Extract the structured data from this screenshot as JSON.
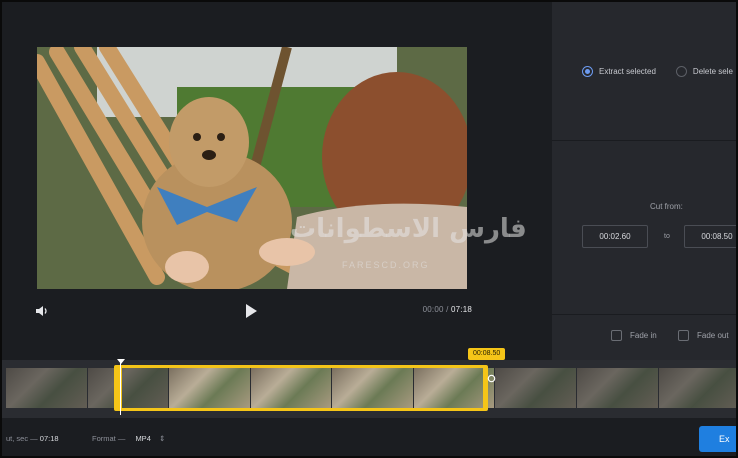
{
  "player": {
    "time_current": "00:00",
    "time_separator": "/",
    "time_total": "07:18"
  },
  "panel": {
    "options": [
      {
        "label": "Extract selected",
        "selected": true
      },
      {
        "label": "Delete sele",
        "selected": false
      }
    ],
    "cut_label": "Cut from:",
    "cut_from": "00:02.60",
    "to_label": "to",
    "cut_to": "00:08.50",
    "fade_in_label": "Fade in",
    "fade_out_label": "Fade out"
  },
  "timeline": {
    "selection_time_tip": "00:08.50"
  },
  "bottom_bar": {
    "duration_label": "ut, sec —",
    "duration_value": "07:18",
    "format_label": "Format —",
    "format_value": "MP4",
    "export_label": "Ex"
  },
  "watermark": {
    "text": "فارس الاسطوانات",
    "sub": "FARESCD.ORG"
  },
  "colors": {
    "accent": "#1f7fe0",
    "selection": "#f5c518",
    "radio_active": "#6d9bf0"
  }
}
